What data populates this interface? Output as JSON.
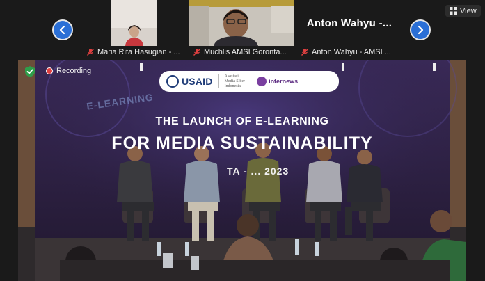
{
  "gallery": {
    "tiles": [
      {
        "name": "Maria Rita Hasugian - ..."
      },
      {
        "name": "Muchlis AMSI Goronta..."
      },
      {
        "name": "Anton Wahyu - AMSI ..."
      }
    ],
    "tile3_display_name": "Anton Wahyu -..."
  },
  "view_menu": {
    "label": "View"
  },
  "status": {
    "recording_label": "Recording"
  },
  "shared_video": {
    "logo_usaid": "USAID",
    "logo_amsi_line1": "Asosiasi",
    "logo_amsi_line2": "Media Siber",
    "logo_amsi_line3": "Indonesia",
    "logo_internews": "internews",
    "backdrop_watermark": "E-LEARNING",
    "headline_line1": "THE LAUNCH OF E-LEARNING",
    "headline_line2": "FOR MEDIA SUSTAINABILITY",
    "subline": "TA - ... 2023"
  },
  "colors": {
    "accent": "#2a6fd6",
    "muted_red": "#e04040",
    "background": "#1a1a1a"
  }
}
